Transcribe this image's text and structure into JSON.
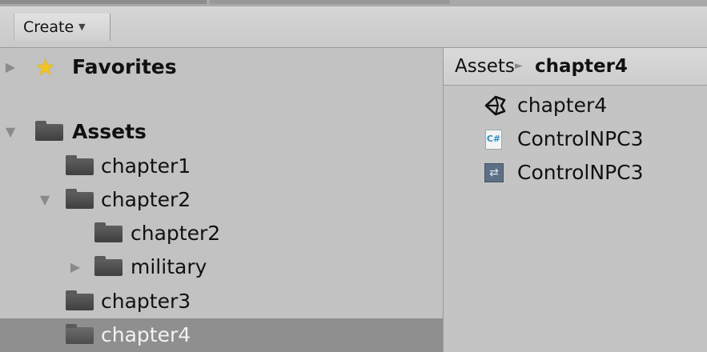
{
  "toolbar": {
    "create_label": "Create",
    "create_caret": "▼"
  },
  "tree": {
    "favorites": {
      "label": "Favorites",
      "expanded": false
    },
    "assets": {
      "label": "Assets",
      "expanded": true
    },
    "items": [
      {
        "label": "chapter1"
      },
      {
        "label": "chapter2",
        "expanded": true
      },
      {
        "label": "chapter2"
      },
      {
        "label": "military",
        "expanded": false
      },
      {
        "label": "chapter3"
      },
      {
        "label": "chapter4",
        "selected": true
      }
    ]
  },
  "breadcrumb": {
    "root": "Assets",
    "separator": "►",
    "current": "chapter4"
  },
  "files": [
    {
      "icon": "unity-scene-icon",
      "label": "chapter4"
    },
    {
      "icon": "csharp-script-icon",
      "glyph": "C#",
      "label": "ControlNPC3"
    },
    {
      "icon": "animator-controller-icon",
      "glyph": "⇄",
      "label": "ControlNPC3"
    }
  ],
  "colors": {
    "panel_bg": "#c2c2c2",
    "selection_bg": "#8f8f8f",
    "star": "#f3c320"
  }
}
